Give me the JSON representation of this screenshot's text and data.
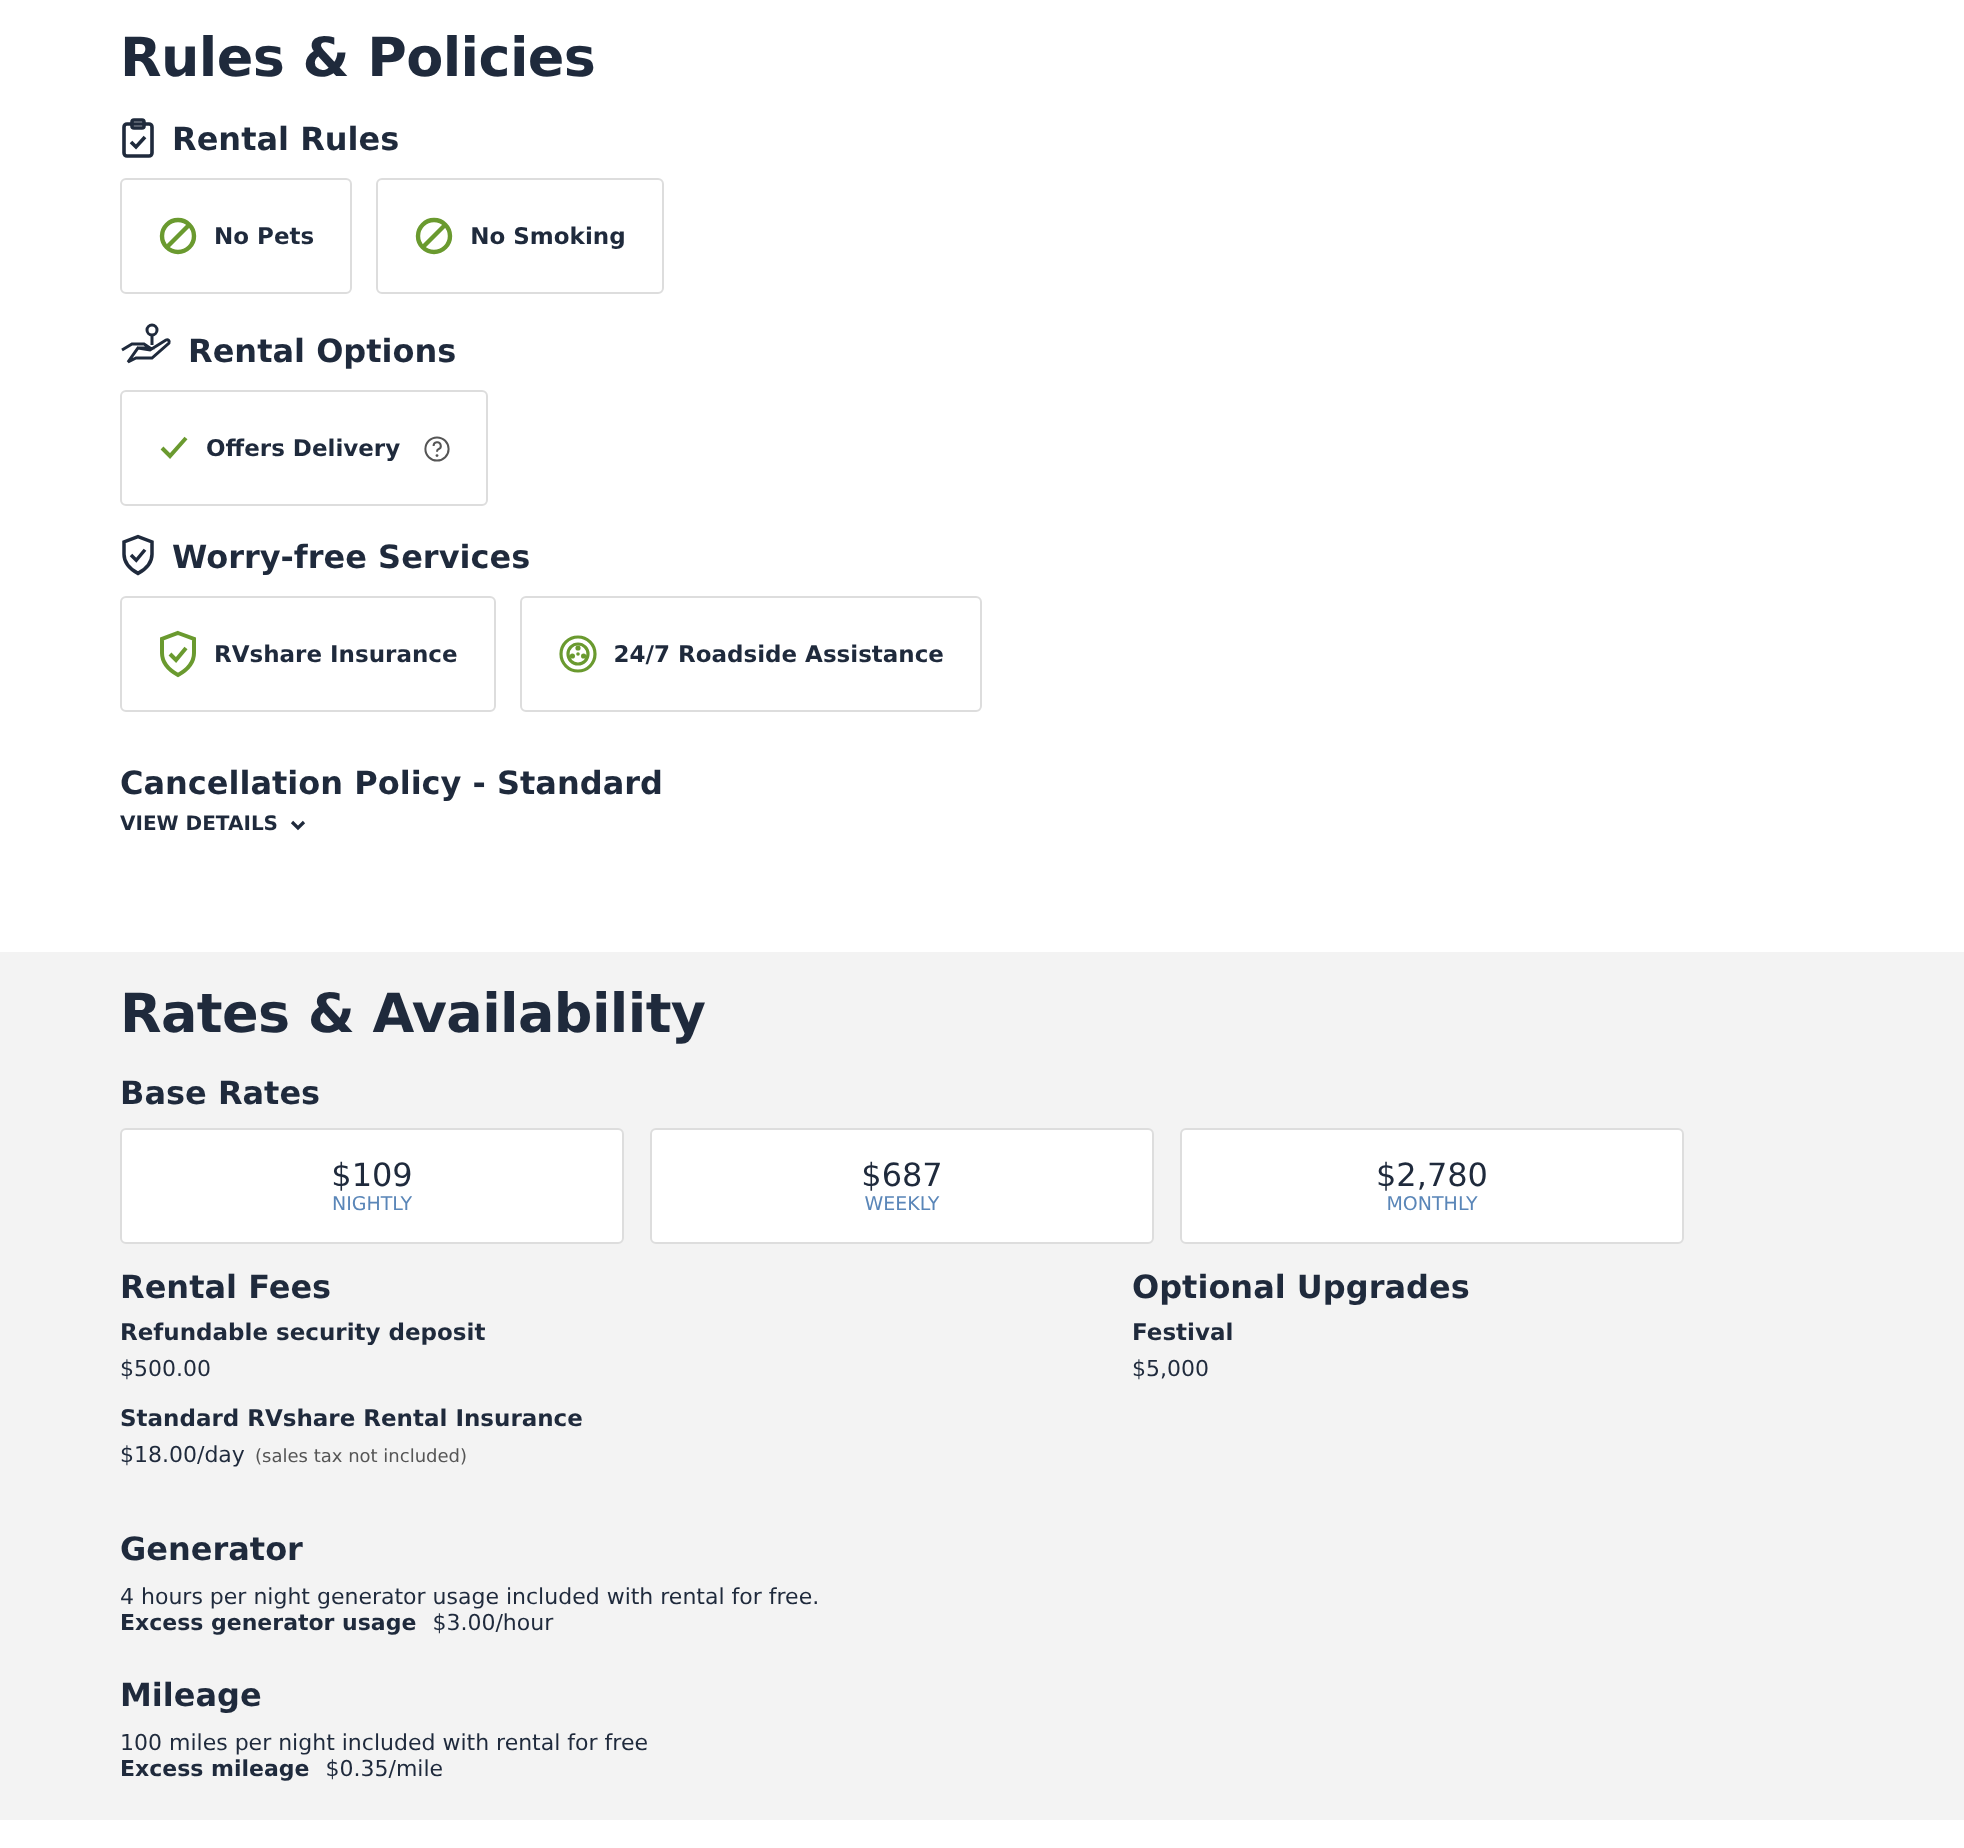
{
  "rules_policies": {
    "title": "Rules & Policies",
    "groups": [
      {
        "kind": "clipboard",
        "title": "Rental Rules",
        "items": [
          {
            "kind": "ban",
            "label": "No Pets"
          },
          {
            "kind": "ban",
            "label": "No Smoking"
          }
        ]
      },
      {
        "kind": "hand",
        "title": "Rental Options",
        "items": [
          {
            "kind": "check",
            "label": "Offers Delivery",
            "help": true
          }
        ]
      },
      {
        "kind": "shield",
        "title": "Worry-free Services",
        "items": [
          {
            "kind": "shield",
            "label": "RVshare Insurance"
          },
          {
            "kind": "wheel",
            "label": "24/7 Roadside Assistance"
          }
        ]
      }
    ],
    "cancellation": {
      "title": "Cancellation Policy - Standard",
      "link": "VIEW DETAILS"
    }
  },
  "rates": {
    "title": "Rates & Availability",
    "base_title": "Base Rates",
    "base_rates": [
      {
        "price": "$109",
        "period": "NIGHTLY"
      },
      {
        "price": "$687",
        "period": "WEEKLY"
      },
      {
        "price": "$2,780",
        "period": "MONTHLY"
      }
    ],
    "rental_fees": {
      "title": "Rental Fees",
      "items": [
        {
          "label": "Refundable security deposit",
          "value": "$500.00"
        },
        {
          "label": "Standard RVshare Rental Insurance",
          "value": "$18.00/day",
          "note": "(sales tax not included)"
        }
      ]
    },
    "optional_upgrades": {
      "title": "Optional Upgrades",
      "items": [
        {
          "label": "Festival",
          "value": "$5,000"
        }
      ]
    },
    "generator": {
      "title": "Generator",
      "description": "4 hours per night generator usage included with rental for free.",
      "excess_label": "Excess generator usage",
      "excess_value": "$3.00/hour"
    },
    "mileage": {
      "title": "Mileage",
      "description": "100 miles per night included with rental for free",
      "excess_label": "Excess mileage",
      "excess_value": "$0.35/mile"
    }
  }
}
